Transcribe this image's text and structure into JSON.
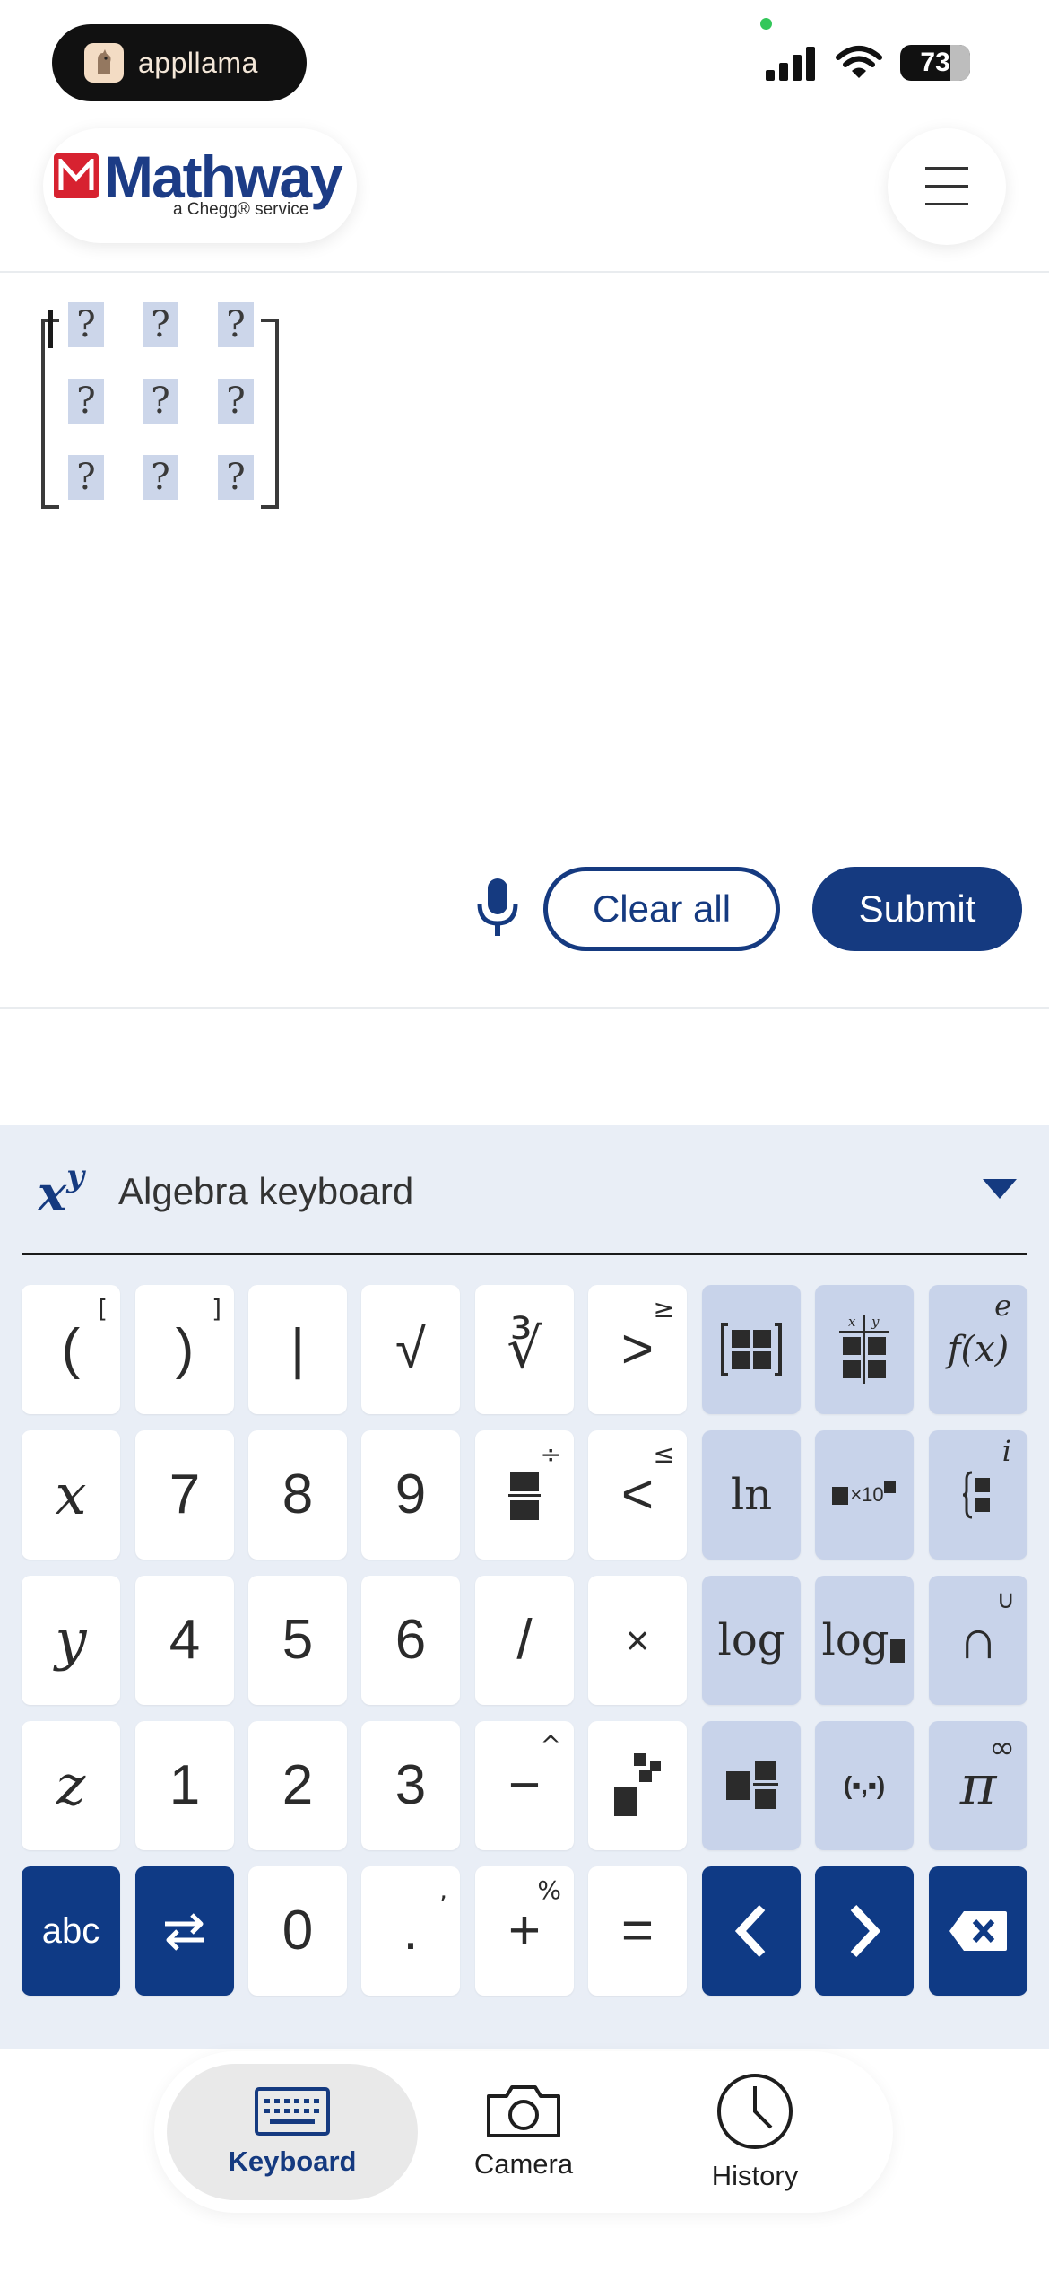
{
  "status_bar": {
    "app_pill": "appllama",
    "battery": "73"
  },
  "header": {
    "brand_name": "Mathway",
    "brand_tagline": "a Chegg® service"
  },
  "editor": {
    "matrix_cells": [
      "?",
      "?",
      "?",
      "?",
      "?",
      "?",
      "?",
      "?",
      "?"
    ]
  },
  "actions": {
    "clear_label": "Clear all",
    "submit_label": "Submit"
  },
  "keyboard": {
    "title": "Algebra keyboard",
    "icon_base": "x",
    "icon_exp": "y",
    "keys": {
      "open_paren": "(",
      "open_bracket": "[",
      "close_paren": ")",
      "close_bracket": "]",
      "abs": "|",
      "sqrt": "√",
      "nth_root": "∛",
      "gt": ">",
      "ge": "≥",
      "fx": "f(x)",
      "e": "e",
      "x": "x",
      "d7": "7",
      "d8": "8",
      "d9": "9",
      "div": "÷",
      "lt": "<",
      "le": "≤",
      "ln": "ln",
      "times10": "×10",
      "i": "i",
      "y": "y",
      "d4": "4",
      "d5": "5",
      "d6": "6",
      "slash": "/",
      "times": "×",
      "log": "log",
      "log_base": "log",
      "intersect": "∩",
      "union": "∪",
      "z": "z",
      "d1": "1",
      "d2": "2",
      "d3": "3",
      "minus": "−",
      "caret": "^",
      "pair": "(▪,▪)",
      "pi": "π",
      "infinity": "∞",
      "abc": "abc",
      "d0": "0",
      "dot": ".",
      "comma": ",",
      "plus": "+",
      "percent": "%",
      "equals": "="
    }
  },
  "tabs": [
    {
      "label": "Keyboard",
      "active": true
    },
    {
      "label": "Camera",
      "active": false
    },
    {
      "label": "History",
      "active": false
    }
  ],
  "colors": {
    "brand_blue": "#153a80",
    "fn_key": "#c8d3ea",
    "keyboard_bg": "#e9eef6"
  }
}
